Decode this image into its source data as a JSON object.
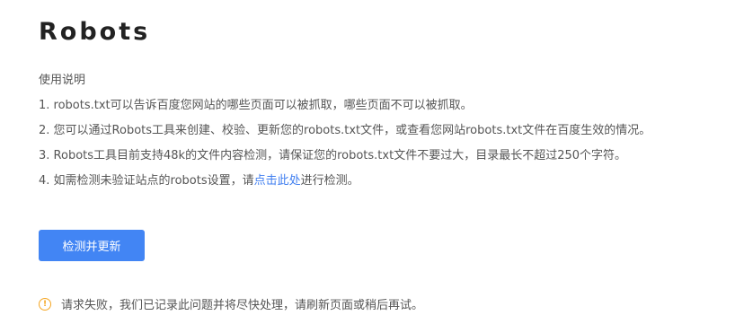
{
  "page": {
    "title": "Robots"
  },
  "instructions": {
    "heading": "使用说明",
    "items": [
      "1. robots.txt可以告诉百度您网站的哪些页面可以被抓取，哪些页面不可以被抓取。",
      "2. 您可以通过Robots工具来创建、校验、更新您的robots.txt文件，或查看您网站robots.txt文件在百度生效的情况。",
      "3. Robots工具目前支持48k的文件内容检测，请保证您的robots.txt文件不要过大，目录最长不超过250个字符。"
    ],
    "item4": {
      "before": "4. 如需检测未验证站点的robots设置，请",
      "link": "点击此处",
      "after": "进行检测。"
    }
  },
  "actions": {
    "check_button": "检测并更新"
  },
  "error": {
    "icon": "warning-icon",
    "message": "请求失败，我们已记录此问题并将尽快处理，请刷新页面或稍后再试。"
  },
  "colors": {
    "accent": "#4285f4",
    "link": "#3f7ef0",
    "warning": "#f5a623"
  }
}
